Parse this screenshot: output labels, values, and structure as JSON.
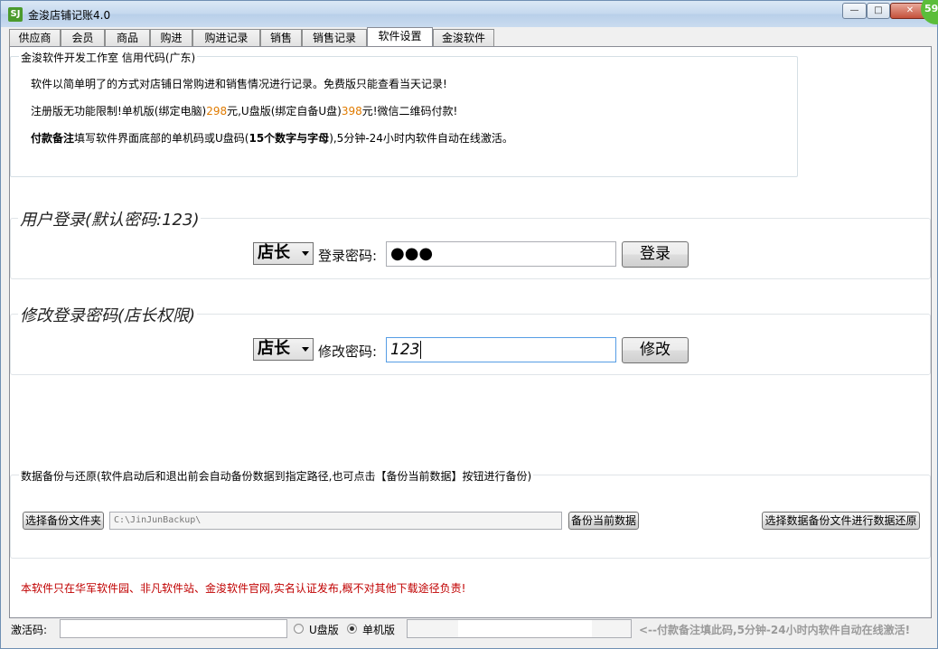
{
  "window": {
    "title": "金浚店铺记账4.0",
    "icon_text": "SJ",
    "badge": "59",
    "minimize_glyph": "—",
    "maximize_glyph": "□",
    "close_glyph": "✕"
  },
  "tabs": [
    {
      "label": "供应商",
      "active": false
    },
    {
      "label": "会员",
      "active": false
    },
    {
      "label": "商品",
      "active": false
    },
    {
      "label": "购进",
      "active": false
    },
    {
      "label": "购进记录",
      "active": false
    },
    {
      "label": "销售",
      "active": false
    },
    {
      "label": "销售记录",
      "active": false
    },
    {
      "label": "软件设置",
      "active": true
    },
    {
      "label": "金浚软件",
      "active": false
    }
  ],
  "info": {
    "legend": "金浚软件开发工作室 信用代码(广东)",
    "line1": "软件以简单明了的方式对店铺日常购进和销售情况进行记录。免费版只能查看当天记录!",
    "line2_a": "注册版无功能限制!单机版(绑定电脑)",
    "line2_price1": "298",
    "line2_b": "元,U盘版(绑定自备U盘)",
    "line2_price2": "398",
    "line2_c": "元!微信二维码付款!",
    "line3_bold1": "付款备注",
    "line3_a": "填写软件界面底部的单机码或U盘码(",
    "line3_bold2": "15个数字与字母",
    "line3_b": "),5分钟-24小时内软件自动在线激活。"
  },
  "login": {
    "legend": "用户登录(默认密码:123)",
    "role": "店长",
    "password_label": "登录密码:",
    "password_value": "●●●",
    "button": "登录"
  },
  "change": {
    "legend": "修改登录密码(店长权限)",
    "role": "店长",
    "password_label": "修改密码:",
    "password_value": "123",
    "button": "修改"
  },
  "backup": {
    "legend": "数据备份与还原(软件启动后和退出前会自动备份数据到指定路径,也可点击【备份当前数据】按钮进行备份)",
    "choose_folder": "选择备份文件夹",
    "path": "C:\\JinJunBackup\\",
    "backup_now": "备份当前数据",
    "restore": "选择数据备份文件进行数据还原"
  },
  "notice": "本软件只在华军软件园、非凡软件站、金浚软件官网,实名认证发布,概不对其他下载途径负责!",
  "status": {
    "activation_label": "激活码:",
    "usb_label": "U盘版",
    "single_label": "单机版",
    "selected": "单机版",
    "hint": "<--付款备注填此码,5分钟-24小时内软件自动在线激活!"
  },
  "colors": {
    "price": "#e07b00",
    "notice": "#c00000",
    "badge": "#5bbd3a"
  }
}
